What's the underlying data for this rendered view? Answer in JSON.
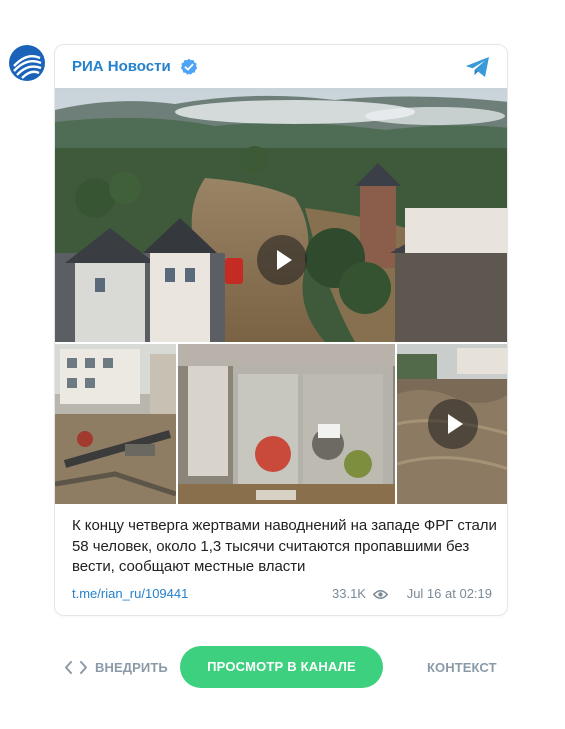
{
  "channel": {
    "name": "РИА Новости",
    "verified": true
  },
  "icons": {
    "avatar": "ria-logo-icon",
    "verified": "verified-check-icon",
    "telegram": "telegram-plane-icon",
    "play": "play-icon",
    "views": "eye-icon",
    "embed": "code-brackets-icon"
  },
  "media": {
    "main": {
      "kind": "video",
      "alt": "flood-town-aerial"
    },
    "thumbs": [
      {
        "kind": "photo",
        "alt": "flood-street-debris"
      },
      {
        "kind": "photo",
        "alt": "flooded-shop-window"
      },
      {
        "kind": "video",
        "alt": "flood-river"
      }
    ]
  },
  "post": {
    "text": "К концу четверга жертвами наводнений на западе ФРГ стали 58 человек, около 1,3 тысячи считаются пропавшими без вести, сообщают местные власти",
    "link": "t.me/rian_ru/109441",
    "views": "33.1K",
    "date": "Jul 16 at 02:19"
  },
  "footer": {
    "embed_label": "ВНЕДРИТЬ",
    "view_channel_label": "ПРОСМОТР В КАНАЛЕ",
    "context_label": "КОНТЕКСТ"
  },
  "colors": {
    "link": "#2481cc",
    "accent_button": "#3dd07f",
    "muted": "#8a9aa8"
  }
}
